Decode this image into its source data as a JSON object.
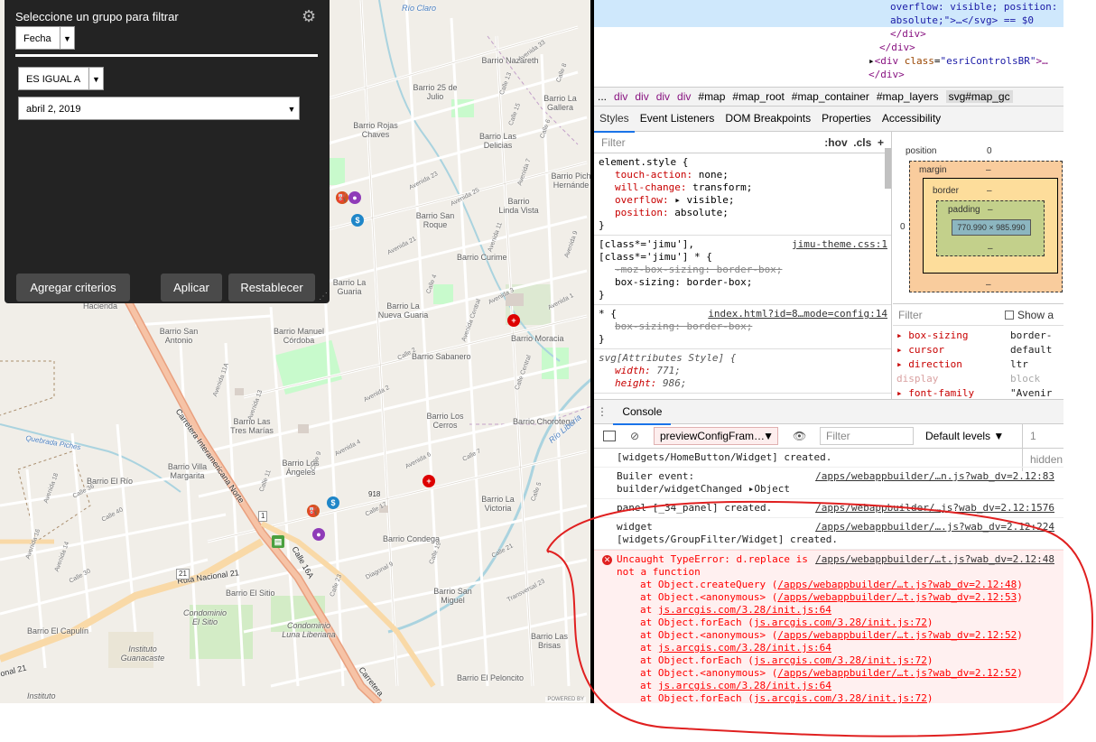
{
  "map": {
    "labels": {
      "rio_claro": "Río Claro",
      "barrio_nazareth": "Barrio Nazareth",
      "barrio_25_julio": "Barrio 25 de Julio",
      "barrio_la_gallera": "Barrio La Gallera",
      "barrio_rojas_chaves": "Barrio Rojas Chaves",
      "barrio_las_delicias": "Barrio Las Delicias",
      "barrio_pich_hernandez": "Barrio Pich Hernánde",
      "barrio_linda_vista": "Barrio Linda Vista",
      "barrio_san_roque": "Barrio San Roque",
      "barrio_curime": "Barrio Curime",
      "barrio_la_guaria": "Barrio La Guaria",
      "hacienda": "Hacienda",
      "barrio_san_antonio": "Barrio San Antonio",
      "barrio_manuel_cordoba": "Barrio Manuel Córdoba",
      "barrio_la_nueva_guaria": "Barrio La Nueva Guaria",
      "barrio_moracia": "Barrio Moracia",
      "barrio_sabanero": "Barrio Sabanero",
      "barrio_las_tres_marias": "Barrio Las Tres Marías",
      "barrio_los_cerros": "Barrio Los Cerros",
      "barrio_chorotega": "Barrio Chorotega",
      "rio_liberia": "Río Liberia",
      "quebrada_piches": "Quebrada Piches",
      "barrio_villa_margarita": "Barrio Villa Margarita",
      "barrio_el_rio": "Barrio El Río",
      "barrio_los_angeles": "Barrio Los Ángeles",
      "barrio_la_victoria": "Barrio La Victoria",
      "barrio_condega": "Barrio Condega",
      "ruta_nacional_21": "Ruta Nacional 21",
      "barrio_el_sitio": "Barrio El Sitio",
      "condominio_el_sitio": "Condominio El Sitio",
      "condominio_luna_liberiana": "Condominio Luna Liberiana",
      "barrio_san_miguel": "Barrio San Miguel",
      "barrio_las_brisas": "Barrio Las Brisas",
      "barrio_el_peloncito": "Barrio El Peloncito",
      "barrio_el_capulin": "Barrio El Capulín",
      "instituto_guanacaste": "Instituto Guanacaste",
      "instituto": "Instituto",
      "carretera_interamericana_norte": "Carretera Interamericana Norte",
      "carretera": "Carretera",
      "calle_16a": "Calle 16A",
      "nal_21": "onal 21",
      "num_918": "918",
      "num_21": "21",
      "num_1": "1"
    },
    "streets": [
      "Avenida 33",
      "Calle 13",
      "Calle 15",
      "Avenida 25",
      "Avenida 23",
      "Avenida 21",
      "Calle 8",
      "Calle 6",
      "Avenida 7",
      "Avenida 9",
      "Avenida 11",
      "Calle 4",
      "Calle 2",
      "Avenida 3",
      "Avenida 1",
      "Avenida Central",
      "Calle Central",
      "Avenida 2",
      "Avenida 4",
      "Avenida 6",
      "Calle 5",
      "Calle 7",
      "Calle 9",
      "Calle 11",
      "Calle 17",
      "Calle 19",
      "Calle 21",
      "Calle 23",
      "Diagonal 9",
      "Transversal 23",
      "Avenida 14",
      "Avenida 16",
      "Avenida 18",
      "Calle 36",
      "Calle 40",
      "Calle 30",
      "Avenida 11A",
      "Avenida 13"
    ],
    "attribution": "POWERED BY"
  },
  "panel": {
    "title": "Seleccione un grupo para filtrar",
    "group_value": "Fecha",
    "operator_value": "ES IGUAL A",
    "date_value": "abril 2, 2019",
    "add_criteria": "Agregar criterios",
    "apply": "Aplicar",
    "reset": "Restablecer"
  },
  "devtools": {
    "elements": {
      "line1_a": "overflow: visible; position:",
      "line2_a": "absolute;\">…</svg> == $0",
      "line3": "</div>",
      "line4": "</div>",
      "line5_tag": "<div ",
      "line5_attr": "class",
      "line5_val": "\"esriControlsBR\"",
      "line5_end": ">…",
      "line6": "</div>"
    },
    "breadcrumbs": [
      "...",
      "div",
      "div",
      "div",
      "div",
      "#map",
      "#map_root",
      "#map_container",
      "#map_layers",
      "svg#map_gc"
    ],
    "style_tabs": [
      "Styles",
      "Event Listeners",
      "DOM Breakpoints",
      "Properties",
      "Accessibility"
    ],
    "styles_filter": {
      "placeholder": "Filter",
      "hov": ":hov",
      "cls": ".cls",
      "plus": "+"
    },
    "rules": {
      "element_selector": "element.style {",
      "element_props": [
        "touch-action: none;",
        "will-change: transform;",
        "overflow: ▸ visible;",
        "position: absolute;"
      ],
      "jimu_selector": "[class*='jimu'],",
      "jimu_selector2": "[class*='jimu'] * {",
      "jimu_source": "jimu-theme.css:1",
      "jimu_props_struck": "-moz-box-sizing: border-box;",
      "jimu_props": "box-sizing: border-box;",
      "star_selector": "* {",
      "star_source": "index.html?id=8…mode=config:14",
      "star_props_struck": "box-sizing: border-box;",
      "svg_selector": "svg[Attributes Style] {",
      "svg_props": [
        "width: 771;",
        "height: 986;"
      ],
      "close": "}"
    },
    "box_model": {
      "position": "position",
      "position_val": "0",
      "margin": "margin",
      "border": "border",
      "padding": "padding",
      "dash": "–",
      "size": "770.990 × 985.990",
      "left_zero": "0"
    },
    "computed": {
      "filter": "Filter",
      "show_all": "Show a",
      "rows": [
        {
          "name": "box-sizing",
          "value": "border-"
        },
        {
          "name": "cursor",
          "value": "default"
        },
        {
          "name": "direction",
          "value": "ltr"
        },
        {
          "name": "display",
          "value": "block"
        },
        {
          "name": "font-family",
          "value": "\"Avenir"
        }
      ]
    },
    "console": {
      "tab": "Console",
      "context": "previewConfigFram…",
      "filter_placeholder": "Filter",
      "levels": "Default levels ▼",
      "hidden": "1 hidden",
      "messages": [
        {
          "text": "[widgets/HomeButton/Widget] created.",
          "src": ""
        },
        {
          "text": "Builer event:\nbuilder/widgetChanged ▸Object",
          "src": "/apps/webappbuilder/…n.js?wab_dv=2.12:83"
        },
        {
          "text": "panel [_34_panel] created.",
          "src": "/apps/webappbuilder/…js?wab_dv=2.12:1576"
        },
        {
          "text": "widget\n[widgets/GroupFilter/Widget] created.",
          "src": "/apps/webappbuilder/….js?wab_dv=2.12:224"
        }
      ],
      "error": {
        "icon": "✕",
        "text": "Uncaught TypeError: d.replace is\nnot a function",
        "src": "/apps/webappbuilder/…t.js?wab_dv=2.12:48",
        "stack": [
          {
            "fn": "at Object.createQuery (",
            "link": "/apps/webappbuilder/…t.js?wab_dv=2.12:48",
            "end": ")"
          },
          {
            "fn": "at Object.<anonymous> (",
            "link": "/apps/webappbuilder/…t.js?wab_dv=2.12:53",
            "end": ")"
          },
          {
            "fn": "at ",
            "link": "js.arcgis.com/3.28/init.js:64",
            "end": ""
          },
          {
            "fn": "at Object.forEach (",
            "link": "js.arcgis.com/3.28/init.js:72",
            "end": ")"
          },
          {
            "fn": "at Object.<anonymous> (",
            "link": "/apps/webappbuilder/…t.js?wab_dv=2.12:52",
            "end": ")"
          },
          {
            "fn": "at ",
            "link": "js.arcgis.com/3.28/init.js:64",
            "end": ""
          },
          {
            "fn": "at Object.forEach (",
            "link": "js.arcgis.com/3.28/init.js:72",
            "end": ")"
          },
          {
            "fn": "at Object.<anonymous> (",
            "link": "/apps/webappbuilder/…t.js?wab_dv=2.12:52",
            "end": ")"
          },
          {
            "fn": "at ",
            "link": "js.arcgis.com/3.28/init.js:64",
            "end": ""
          },
          {
            "fn": "at Object.forEach (",
            "link": "js.arcgis.com/3.28/init.js:72",
            "end": ")"
          }
        ]
      }
    }
  },
  "colors": {
    "panel_bg": "#232323",
    "highway": "#e8a28a",
    "annotation": "#e02020",
    "error_text": "#ff0000"
  }
}
